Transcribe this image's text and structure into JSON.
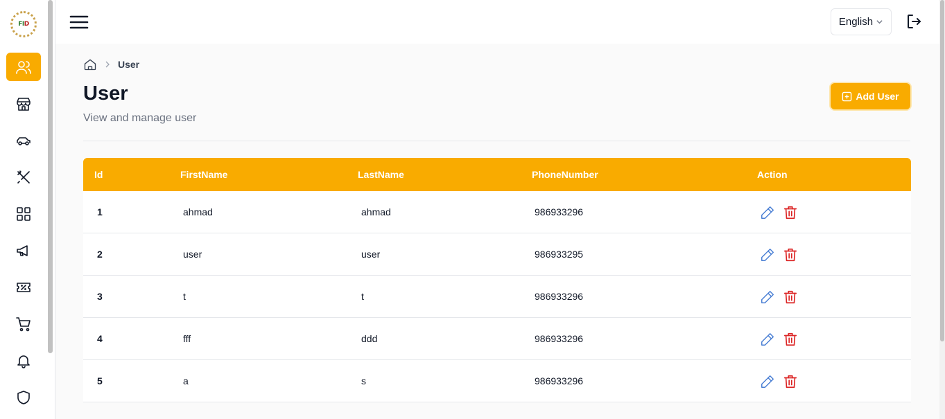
{
  "sidebar": {
    "logo_text_a": "FI",
    "logo_text_b": "D",
    "items": [
      {
        "name": "users",
        "icon": "users-icon",
        "active": true
      },
      {
        "name": "stores",
        "icon": "store-icon",
        "active": false
      },
      {
        "name": "vehicles",
        "icon": "car-icon",
        "active": false
      },
      {
        "name": "restaurants",
        "icon": "utensils-icon",
        "active": false
      },
      {
        "name": "categories",
        "icon": "grid-icon",
        "active": false
      },
      {
        "name": "ads",
        "icon": "megaphone-icon",
        "active": false
      },
      {
        "name": "coupons",
        "icon": "ticket-icon",
        "active": false
      },
      {
        "name": "orders",
        "icon": "cart-icon",
        "active": false
      },
      {
        "name": "notifications",
        "icon": "bell-icon",
        "active": false
      },
      {
        "name": "security",
        "icon": "shield-icon",
        "active": false
      }
    ]
  },
  "topbar": {
    "language": "English"
  },
  "breadcrumb": {
    "current": "User"
  },
  "page": {
    "title": "User",
    "subtitle": "View and manage user",
    "add_button": "Add User"
  },
  "table": {
    "columns": [
      "Id",
      "FirstName",
      "LastName",
      "PhoneNumber",
      "Action"
    ],
    "rows": [
      {
        "id": "1",
        "first": "ahmad",
        "last": "ahmad",
        "phone": "986933296"
      },
      {
        "id": "2",
        "first": "user",
        "last": "user",
        "phone": "986933295"
      },
      {
        "id": "3",
        "first": "t",
        "last": "t",
        "phone": "986933296"
      },
      {
        "id": "4",
        "first": "fff",
        "last": "ddd",
        "phone": "986933296"
      },
      {
        "id": "5",
        "first": "a",
        "last": "s",
        "phone": "986933296"
      }
    ]
  },
  "colors": {
    "accent": "#f9ab00",
    "edit": "#4a7fd4",
    "delete": "#dc2626"
  }
}
